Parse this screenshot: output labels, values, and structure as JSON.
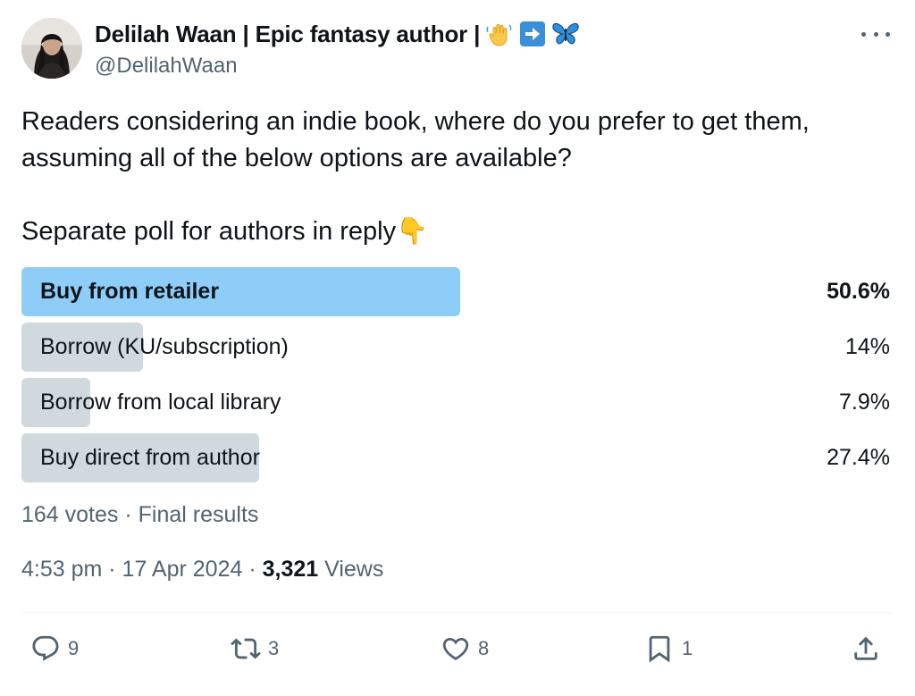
{
  "author": {
    "display_name": "Delilah Waan | Epic fantasy author |",
    "handle": "@DelilahWaan",
    "emojis": [
      "waving-hand-emoji",
      "right-arrow-emoji",
      "butterfly-emoji"
    ]
  },
  "tweet": {
    "line1": "Readers considering an indie book, where do you prefer to get them,",
    "line2": "assuming all of the below options are available?",
    "line3": "Separate poll for authors in reply👇"
  },
  "poll": {
    "options": [
      {
        "label": "Buy from retailer",
        "percent_text": "50.6%",
        "percent": 50.6,
        "winner": true
      },
      {
        "label": "Borrow (KU/subscription)",
        "percent_text": "14%",
        "percent": 14,
        "winner": false
      },
      {
        "label": "Borrow from local library",
        "percent_text": "7.9%",
        "percent": 7.9,
        "winner": false
      },
      {
        "label": "Buy direct from author",
        "percent_text": "27.4%",
        "percent": 27.4,
        "winner": false
      }
    ],
    "meta": "164 votes · Final results"
  },
  "timestamp": {
    "time_date": "4:53 pm · 17 Apr 2024 · ",
    "views_count": "3,321",
    "views_label": " Views"
  },
  "actions": {
    "replies": "9",
    "reposts": "3",
    "likes": "8",
    "bookmarks": "1"
  },
  "colors": {
    "winner_bar": "#8ecdf8",
    "option_bar": "#cfd9de",
    "secondary_text": "#536471",
    "primary_text": "#0f1419"
  }
}
